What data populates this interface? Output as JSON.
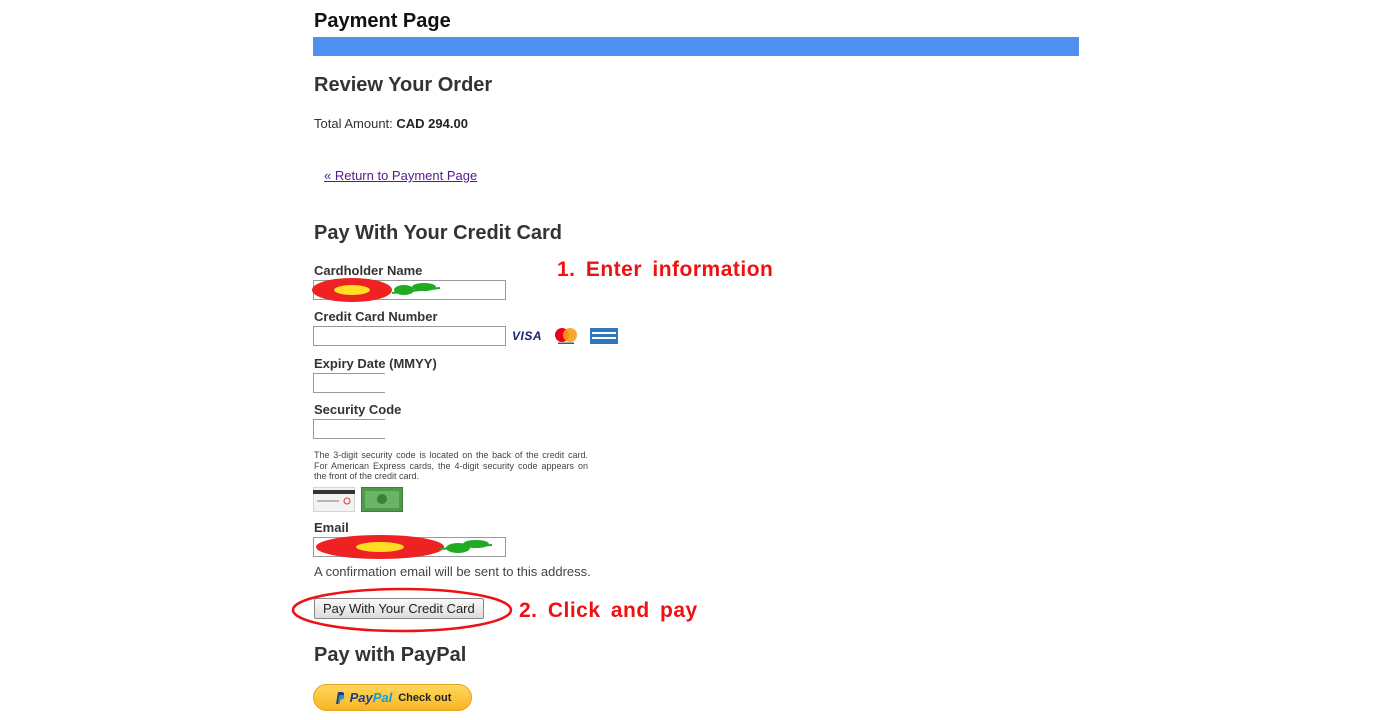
{
  "page_title": "Payment Page",
  "colors": {
    "accent_bar": "#4f8fef",
    "annotation": "#ee1111",
    "link": "#551a8b",
    "paypal_button": "#f8c43a"
  },
  "review": {
    "title": "Review Your Order",
    "total_label": "Total Amount:",
    "total_value": "CAD 294.00",
    "return_link": "« Return to Payment Page"
  },
  "credit_card": {
    "title": "Pay With Your Credit Card",
    "cardholder_label": "Cardholder Name",
    "cardholder_value": "",
    "number_label": "Credit Card Number",
    "number_value": "",
    "card_brands": [
      "VISA",
      "Mastercard",
      "American Express"
    ],
    "expiry_label": "Expiry Date (MMYY)",
    "expiry_value": "",
    "security_label": "Security Code",
    "security_value": "",
    "security_help": "The 3-digit security code is located on the back of the credit card. For American Express cards, the 4-digit security code appears on the front of the credit card.",
    "email_label": "Email",
    "email_value": "",
    "email_note": "A confirmation email will be sent to this address.",
    "pay_button": "Pay With Your Credit Card"
  },
  "paypal": {
    "title": "Pay with PayPal",
    "logo_pay": "Pay",
    "logo_pal": "Pal",
    "checkout_label": "Check out"
  },
  "annotations": {
    "step1": "1. Enter information",
    "step2": "2. Click and pay"
  },
  "icons": [
    "visa-logo-icon",
    "mastercard-logo-icon",
    "amex-logo-icon",
    "security-code-back-icon",
    "security-code-front-icon",
    "paypal-p-icon",
    "redaction-flower-icon"
  ]
}
